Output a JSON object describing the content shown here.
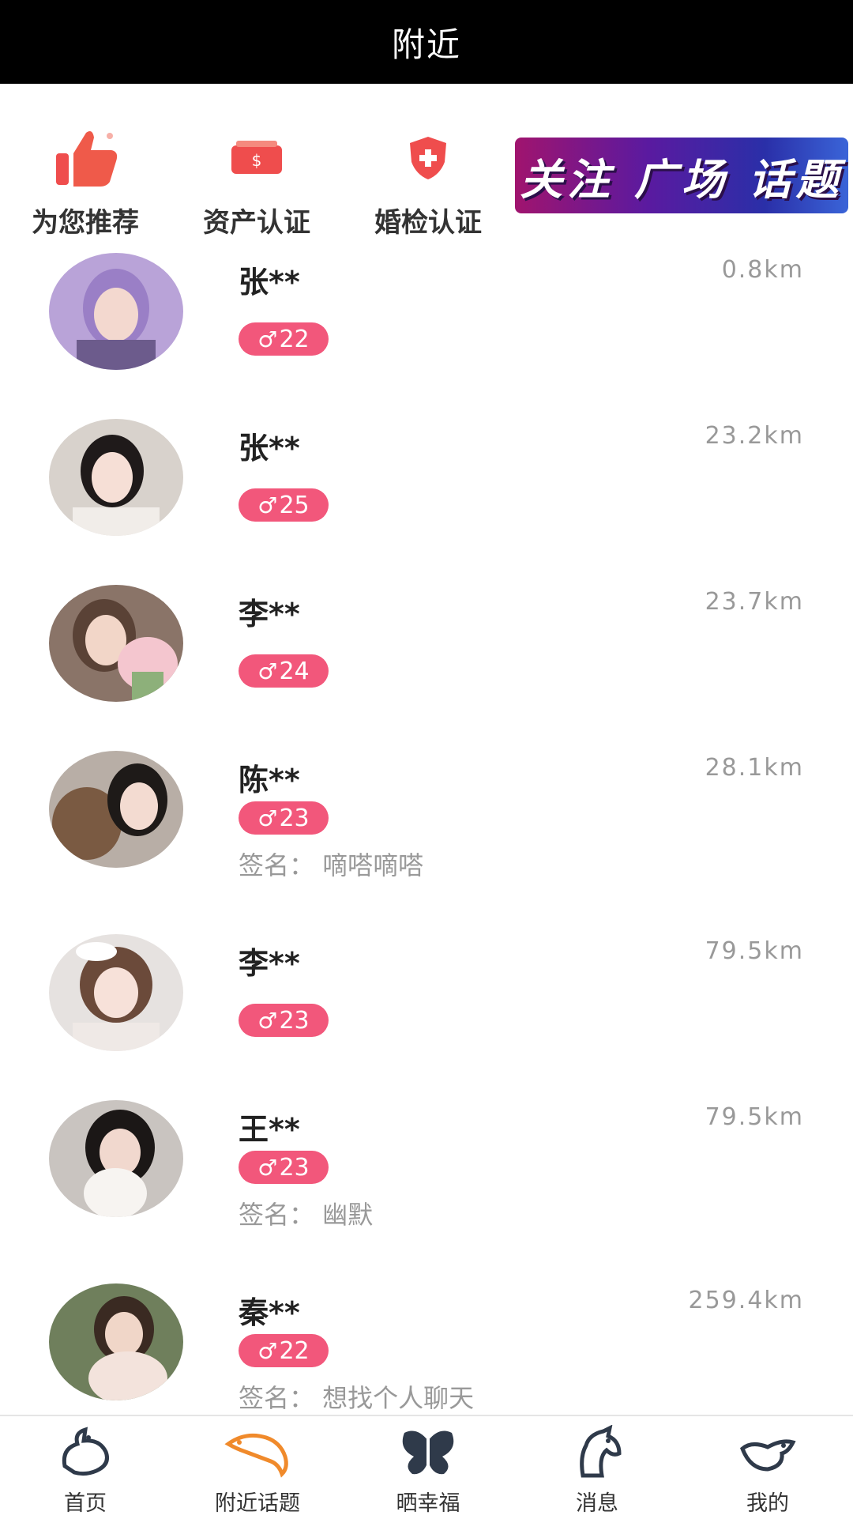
{
  "header": {
    "title": "附近"
  },
  "shortcuts": [
    {
      "label": "为您推荐",
      "icon": "thumbs-up-icon"
    },
    {
      "label": "资产认证",
      "icon": "money-icon"
    },
    {
      "label": "婚检认证",
      "icon": "shield-plus-icon"
    }
  ],
  "banner": {
    "text": "关注 广场 话题"
  },
  "users": [
    {
      "name": "张**",
      "age": "22",
      "gender_symbol": "♂",
      "distance": "0.8km",
      "signature": ""
    },
    {
      "name": "张**",
      "age": "25",
      "gender_symbol": "♂",
      "distance": "23.2km",
      "signature": ""
    },
    {
      "name": "李**",
      "age": "24",
      "gender_symbol": "♂",
      "distance": "23.7km",
      "signature": ""
    },
    {
      "name": "陈**",
      "age": "23",
      "gender_symbol": "♂",
      "distance": "28.1km",
      "signature": "签名：  嘀嗒嘀嗒"
    },
    {
      "name": "李**",
      "age": "23",
      "gender_symbol": "♂",
      "distance": "79.5km",
      "signature": ""
    },
    {
      "name": "王**",
      "age": "23",
      "gender_symbol": "♂",
      "distance": "79.5km",
      "signature": "签名：  幽默"
    },
    {
      "name": "秦**",
      "age": "22",
      "gender_symbol": "♂",
      "distance": "259.4km",
      "signature": "签名：  想找个人聊天"
    }
  ],
  "tabs": [
    {
      "label": "首页",
      "icon": "dove-icon"
    },
    {
      "label": "附近话题",
      "icon": "dolphin-icon",
      "active": true
    },
    {
      "label": "晒幸福",
      "icon": "butterfly-icon"
    },
    {
      "label": "消息",
      "icon": "horse-icon"
    },
    {
      "label": "我的",
      "icon": "bird-icon"
    }
  ],
  "colors": {
    "badge": "#f2577b",
    "accent_orange": "#f08a2b",
    "shortcut_red": "#ef4d4d"
  }
}
